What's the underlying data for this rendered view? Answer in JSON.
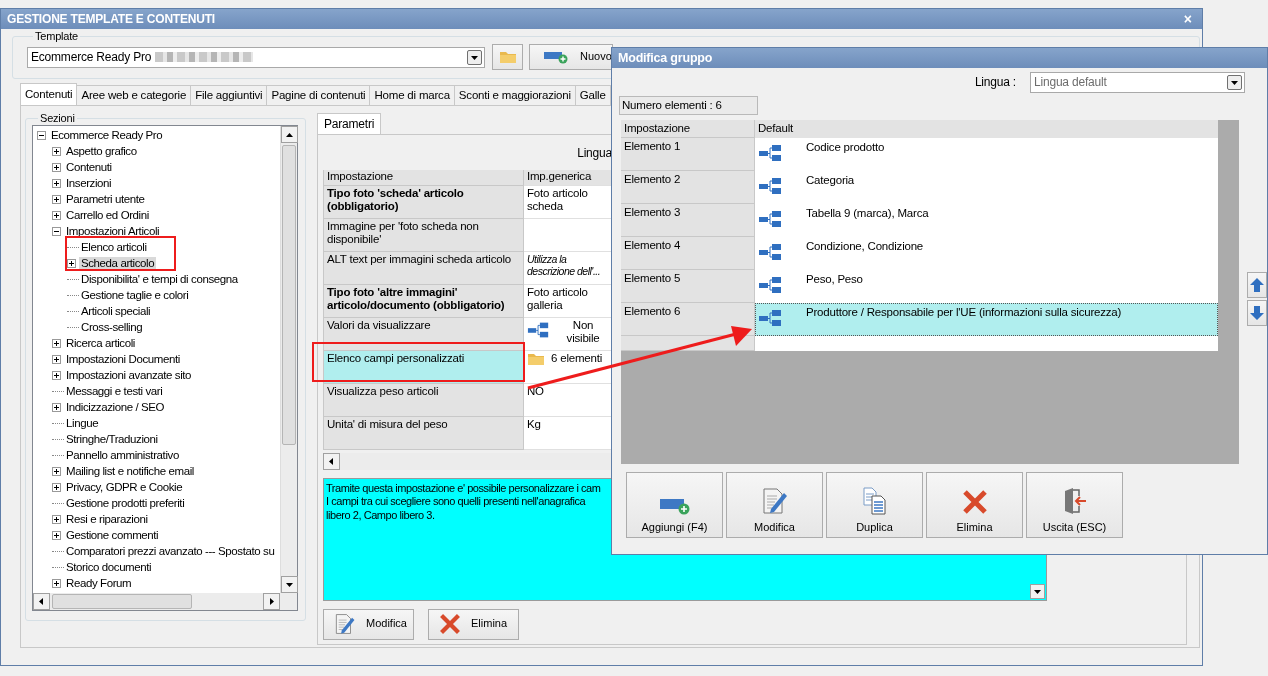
{
  "main_window": {
    "title": "GESTIONE TEMPLATE E CONTENUTI",
    "close": "×",
    "template": {
      "label": "Template",
      "value": "Ecommerce Ready Pro",
      "new_button": "Nuovo"
    },
    "tabs": [
      {
        "label": "Contenuti",
        "selected": true
      },
      {
        "label": "Aree web e categorie",
        "selected": false
      },
      {
        "label": "File aggiuntivi",
        "selected": false
      },
      {
        "label": "Pagine di contenuti",
        "selected": false
      },
      {
        "label": "Home di marca",
        "selected": false
      },
      {
        "label": "Sconti e maggiorazioni",
        "selected": false
      },
      {
        "label": "Galle",
        "selected": false
      }
    ],
    "sections": {
      "label": "Sezioni",
      "tree": [
        {
          "label": "Ecommerce Ready Pro",
          "expanded": true,
          "selected": false,
          "children": [
            {
              "label": "Aspetto grafico",
              "expanded": false,
              "selected": false
            },
            {
              "label": "Contenuti",
              "expanded": false,
              "selected": false
            },
            {
              "label": "Inserzioni",
              "expanded": false,
              "selected": false
            },
            {
              "label": "Parametri utente",
              "expanded": false,
              "selected": false
            },
            {
              "label": "Carrello ed Ordini",
              "expanded": false,
              "selected": false
            },
            {
              "label": "Impostazioni Articoli",
              "expanded": true,
              "selected": false,
              "children": [
                {
                  "label": "Elenco articoli",
                  "selected": false
                },
                {
                  "label": "Scheda articolo",
                  "expanded": false,
                  "selected": true
                },
                {
                  "label": "Disponibilita' e tempi di consegna",
                  "selected": false
                },
                {
                  "label": "Gestione taglie e colori",
                  "selected": false
                },
                {
                  "label": "Articoli speciali",
                  "selected": false
                },
                {
                  "label": "Cross-selling",
                  "selected": false
                }
              ]
            },
            {
              "label": "Ricerca articoli",
              "expanded": false,
              "selected": false
            },
            {
              "label": "Impostazioni Documenti",
              "expanded": false,
              "selected": false
            },
            {
              "label": "Impostazioni avanzate sito",
              "expanded": false,
              "selected": false
            },
            {
              "label": "Messaggi e testi vari",
              "selected": false
            },
            {
              "label": "Indicizzazione / SEO",
              "expanded": false,
              "selected": false
            },
            {
              "label": "Lingue",
              "selected": false
            },
            {
              "label": "Stringhe/Traduzioni",
              "selected": false
            },
            {
              "label": "Pannello amministrativo",
              "selected": false
            },
            {
              "label": "Mailing list e notifiche email",
              "expanded": false,
              "selected": false
            },
            {
              "label": "Privacy, GDPR e Cookie",
              "expanded": false,
              "selected": false
            },
            {
              "label": "Gestione prodotti preferiti",
              "selected": false
            },
            {
              "label": "Resi e riparazioni",
              "expanded": false,
              "selected": false
            },
            {
              "label": "Gestione commenti",
              "expanded": false,
              "selected": false
            },
            {
              "label": "Comparatori prezzi avanzato --- Spostato su",
              "selected": false
            },
            {
              "label": "Storico documenti",
              "selected": false
            },
            {
              "label": "Ready Forum",
              "expanded": false,
              "selected": false
            }
          ]
        }
      ]
    },
    "parameters": {
      "tab": "Parametri",
      "language_label": "Lingua",
      "columns": [
        "Impostazione",
        "Imp.generica"
      ],
      "rows": [
        {
          "setting": "Tipo foto 'scheda' articolo (obbligatorio)",
          "value": "Foto articolo scheda",
          "kind": "text",
          "bold": true,
          "italic": false,
          "selected": false
        },
        {
          "setting": "Immagine per 'foto scheda non disponibile'",
          "kind": "empty",
          "bold": false,
          "selected": false
        },
        {
          "setting": "ALT text per immagini scheda articolo",
          "value": "Utilizza la descrizione dell'...",
          "kind": "text",
          "bold": false,
          "italic": true,
          "selected": false
        },
        {
          "setting": "Tipo foto 'altre immagini' articolo/documento (obbligatorio)",
          "value": "Foto articolo galleria",
          "kind": "text",
          "bold": true,
          "italic": false,
          "selected": false
        },
        {
          "setting": "Valori da visualizzare",
          "value": "Non visibile",
          "kind": "hierarchy",
          "bold": false,
          "italic": false,
          "selected": false
        },
        {
          "setting": "Elenco campi personalizzati",
          "value": "6 elementi",
          "kind": "folder",
          "bold": false,
          "italic": false,
          "selected": true
        },
        {
          "setting": "Visualizza peso articoli",
          "value": "NO",
          "kind": "text",
          "bold": false,
          "italic": false,
          "selected": false
        },
        {
          "setting": "Unita' di misura del peso",
          "value": "Kg",
          "kind": "text",
          "bold": false,
          "italic": false,
          "selected": false
        }
      ],
      "description": "Tramite questa impostazione e' possibile personalizzare i cam\nI campi tra cui scegliere sono quelli presenti nell'anagrafica\nlibero 2, Campo libero 3.",
      "buttons": [
        {
          "label": "Modifica",
          "kind": "edit"
        },
        {
          "label": "Elimina",
          "kind": "delete"
        }
      ]
    }
  },
  "dialog": {
    "title": "Modifica gruppo",
    "language_label": "Lingua :",
    "language_value": "Lingua default",
    "count": "Numero elementi : 6",
    "columns": [
      "Impostazione",
      "Default"
    ],
    "rows": [
      {
        "name": "Elemento 1",
        "value": "Codice prodotto",
        "selected": false
      },
      {
        "name": "Elemento 2",
        "value": "Categoria",
        "selected": false
      },
      {
        "name": "Elemento 3",
        "value": "Tabella 9 (marca), Marca",
        "selected": false
      },
      {
        "name": "Elemento 4",
        "value": "Condizione, Condizione",
        "selected": false
      },
      {
        "name": "Elemento 5",
        "value": "Peso, Peso",
        "selected": false
      },
      {
        "name": "Elemento 6",
        "value": "Produttore / Responsabile per l'UE (informazioni sulla sicurezza)",
        "selected": true
      }
    ],
    "buttons": [
      {
        "label": "Aggiungi (F4)",
        "kind": "add"
      },
      {
        "label": "Modifica",
        "kind": "edit"
      },
      {
        "label": "Duplica",
        "kind": "duplicate"
      },
      {
        "label": "Elimina",
        "kind": "delete"
      },
      {
        "label": "Uscita (ESC)",
        "kind": "exit"
      }
    ]
  }
}
